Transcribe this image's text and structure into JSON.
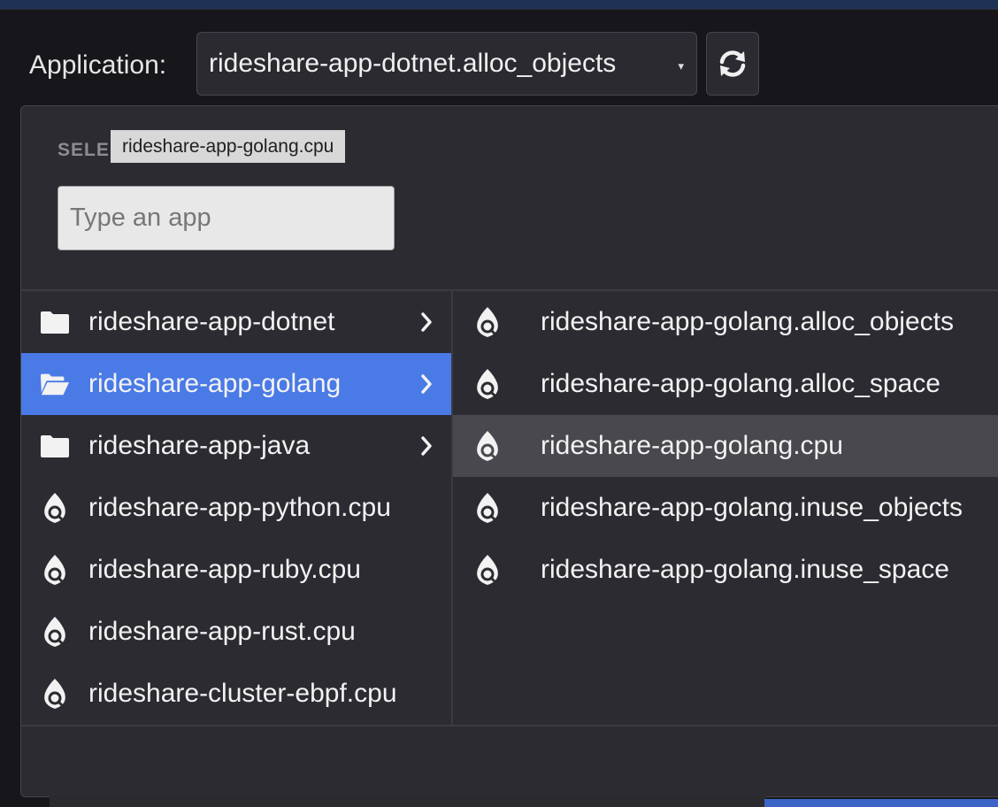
{
  "header": {
    "application_label": "Application:",
    "selected_app": "rideshare-app-dotnet.alloc_objects",
    "caret": "▾"
  },
  "dropdown": {
    "heading": "SELE",
    "tooltip": "rideshare-app-golang.cpu",
    "search_placeholder": "Type an app",
    "left_items": [
      {
        "label": "rideshare-app-dotnet",
        "icon": "folder-icon"
      },
      {
        "label": "rideshare-app-golang",
        "icon": "folder-open-icon"
      },
      {
        "label": "rideshare-app-java",
        "icon": "folder-icon"
      },
      {
        "label": "rideshare-app-python.cpu",
        "icon": "pyroscope-flame-icon"
      },
      {
        "label": "rideshare-app-ruby.cpu",
        "icon": "pyroscope-flame-icon"
      },
      {
        "label": "rideshare-app-rust.cpu",
        "icon": "pyroscope-flame-icon"
      },
      {
        "label": "rideshare-cluster-ebpf.cpu",
        "icon": "pyroscope-flame-icon"
      }
    ],
    "right_items": [
      {
        "label": "rideshare-app-golang.alloc_objects",
        "icon": "pyroscope-flame-icon"
      },
      {
        "label": "rideshare-app-golang.alloc_space",
        "icon": "pyroscope-flame-icon"
      },
      {
        "label": "rideshare-app-golang.cpu",
        "icon": "pyroscope-flame-icon"
      },
      {
        "label": "rideshare-app-golang.inuse_objects",
        "icon": "pyroscope-flame-icon"
      },
      {
        "label": "rideshare-app-golang.inuse_space",
        "icon": "pyroscope-flame-icon"
      }
    ]
  },
  "colors": {
    "selected_row": "#4a7ae6",
    "hover_row": "#48484e",
    "panel_bg": "#2b2b31"
  }
}
